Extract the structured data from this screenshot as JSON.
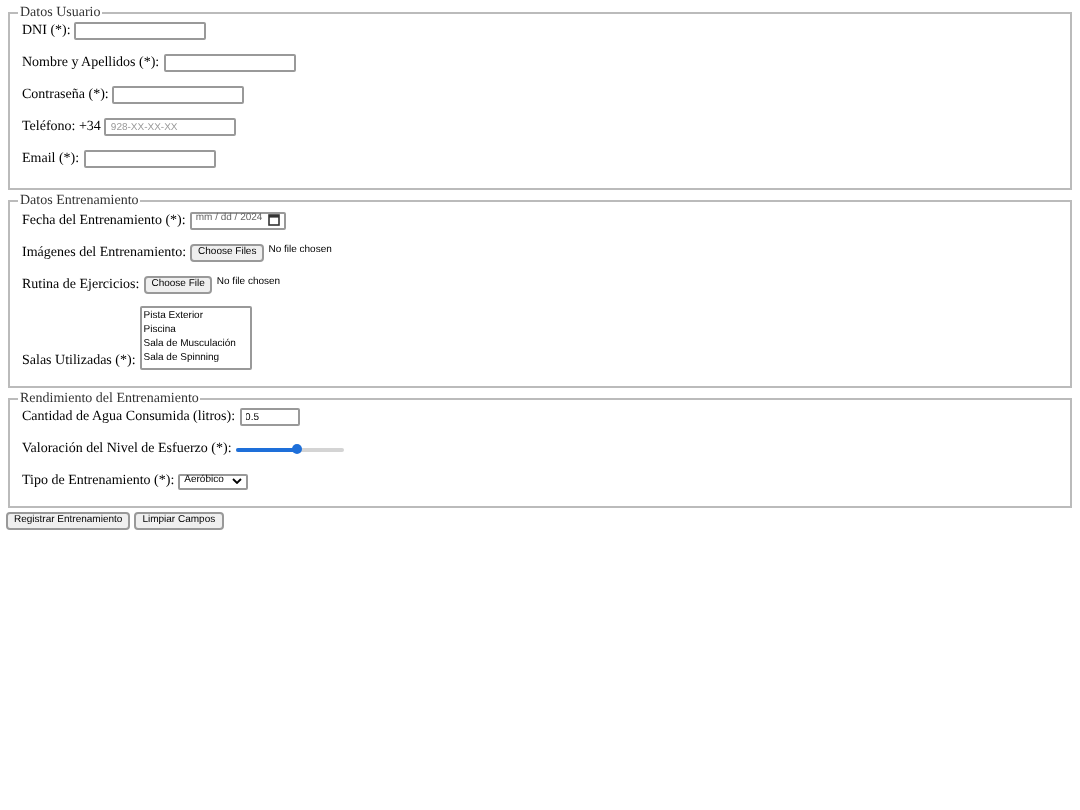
{
  "datos_usuario": {
    "legend": "Datos Usuario",
    "fields": [
      {
        "label": "DNI (*):",
        "kind": "text"
      },
      {
        "label": "Nombre y Apellidos (*):",
        "kind": "text"
      },
      {
        "label": "Contraseña (*):",
        "kind": "text"
      },
      {
        "label": "Teléfono: +34",
        "kind": "text",
        "placeholder": "928-XX-XX-XX"
      },
      {
        "label": "Email (*):",
        "kind": "text"
      }
    ]
  },
  "datos_entrenamiento": {
    "legend": "Datos Entrenamiento",
    "fecha": {
      "label": "Fecha del Entrenamiento (*):",
      "value": "mm / dd / 2024"
    },
    "imagenes": {
      "label": "Imágenes del Entrenamiento:",
      "button": "Choose Files",
      "status": "No file chosen"
    },
    "rutina": {
      "label": "Rutina de Ejercicios:",
      "button": "Choose File",
      "status": "No file chosen"
    },
    "salas": {
      "label": "Salas Utilizadas (*):",
      "options": [
        {
          "label": "Pista Exterior",
          "selected": false
        },
        {
          "label": "Piscina",
          "selected": false
        },
        {
          "label": "Sala de Musculación",
          "selected": false
        },
        {
          "label": "Sala de Spinning",
          "selected": false
        }
      ]
    }
  },
  "rendimiento": {
    "legend": "Rendimiento del Entrenamiento",
    "agua": {
      "label": "Cantidad de Agua Consumida (litros):",
      "value": "0.5"
    },
    "esfuerzo": {
      "label": "Valoración del Nivel de Esfuerzo (*):",
      "level": 0.57
    },
    "tipo": {
      "label": "Tipo de Entrenamiento (*):",
      "value": "Aeróbico"
    }
  },
  "buttons": [
    "Registrar Entrenamiento",
    "Limpiar Campos"
  ]
}
